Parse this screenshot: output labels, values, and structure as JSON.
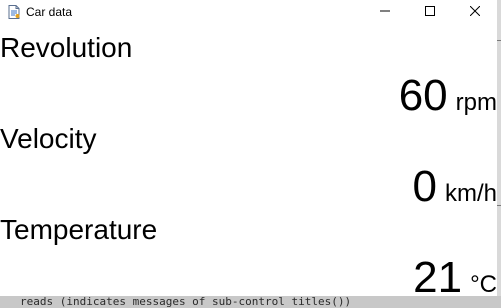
{
  "window": {
    "title": "Car data"
  },
  "rows": [
    {
      "label": "Revolution",
      "value": "60",
      "unit": "rpm"
    },
    {
      "label": "Velocity",
      "value": "0",
      "unit": "km/h"
    },
    {
      "label": "Temperature",
      "value": "21",
      "unit": "°C"
    }
  ],
  "background": {
    "console_text": "reads (indicates messages of sub-control titles())"
  },
  "colors": {
    "window_bg": "#ffffff",
    "text": "#000000",
    "background_dark": "#2b2b2b"
  },
  "icons": {
    "app": "document-icon",
    "minimize": "minimize-icon",
    "maximize": "maximize-icon",
    "close": "close-icon"
  }
}
